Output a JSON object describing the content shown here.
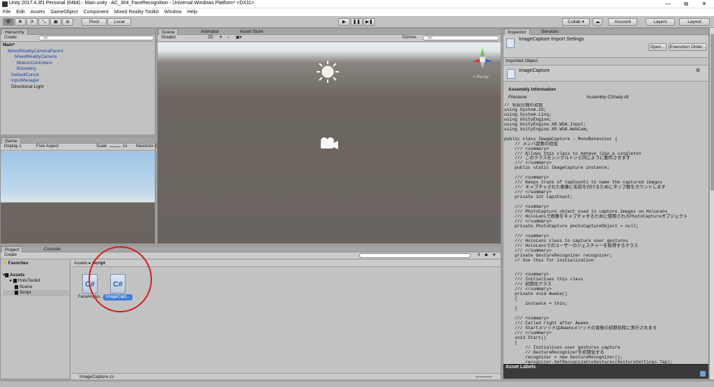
{
  "window": {
    "title": "Unity 2017.4.3f1 Personal (64bit) - Main.unity - AC_304_FaceRecognition - Universal Windows Platform* <DX11>",
    "minimize": "—",
    "maximize": "⧉",
    "close": "✕"
  },
  "menu": [
    "File",
    "Edit",
    "Assets",
    "GameObject",
    "Component",
    "Mixed Reality Toolkit",
    "Window",
    "Help"
  ],
  "toolbar": {
    "pivot": "Pivot",
    "local": "Local",
    "play": "▶",
    "pause": "❚❚",
    "step": "▶❚",
    "collab": "Collab ▾",
    "account": "Account",
    "layers": "Layers",
    "layout": "Layout"
  },
  "hierarchy": {
    "tab": "Hierarchy",
    "create": "Create",
    "search_placeholder": "All",
    "scene": "Main*",
    "items": [
      {
        "label": "MixedRealityCameraParent"
      },
      {
        "label": "MixedRealityCamera"
      },
      {
        "label": "MotionControllers"
      },
      {
        "label": "Boundary"
      },
      {
        "label": "DefaultCursor"
      },
      {
        "label": "InputManager"
      },
      {
        "label": "Directional Light"
      }
    ]
  },
  "game": {
    "tab": "Game",
    "display": "Display 1",
    "aspect": "Free Aspect",
    "scale_label": "Scale",
    "scale_value": "1x",
    "maximize": "Maximize O"
  },
  "scene": {
    "tabs": [
      "Scene",
      "Animator",
      "Asset Store"
    ],
    "shading": "Shaded",
    "mode2d": "2D",
    "gizmos": "Gizmos",
    "search_placeholder": "All",
    "persp": "< Persp"
  },
  "project": {
    "tabs": [
      "Project",
      "Console"
    ],
    "create": "Create",
    "favorites": "Favorites",
    "assets": "Assets",
    "tree": [
      {
        "label": "HoloToolkit"
      },
      {
        "label": "Scene"
      },
      {
        "label": "Script"
      }
    ],
    "breadcrumb_root": "Assets",
    "breadcrumb_sep": "▸",
    "breadcrumb_current": "Script",
    "files": [
      {
        "label": "FaceAnalys...",
        "icon": "C#"
      },
      {
        "label": "ImageCapt...",
        "icon": "C#"
      }
    ],
    "count": "4",
    "footer_file": "ImageCapture.cs"
  },
  "inspector": {
    "tabs": [
      "Inspector",
      "Services"
    ],
    "title": "ImageCapture Import Settings",
    "open_btn": "Open...",
    "exec_order_btn": "Execution Order...",
    "imported_object": "Imported Object",
    "object_name": "ImageCapture",
    "assembly_heading": "Assembly Information",
    "filename_label": "Filename",
    "filename_value": "Assembly-CSharp.dll",
    "asset_labels": "Asset Labels",
    "code": "// 名前空間の追加\nusing System.IO;\nusing System.Linq;\nusing UnityEngine;\nusing UnityEngine.XR.WSA.Input;\nusing UnityEngine.XR.WSA.WebCam;\n\npublic class ImageCapture : MonoBehaviour {\n    // メンバ変数の追加\n    /// <summary>\n    /// Allows this class to behave like a singleton\n    /// このクラスをシングルトンと同じように動作させます\n    /// </summary>\n    public static ImageCapture instance;\n\n    /// <summary>\n    /// Keeps track of tapCounts to name the captured images\n    /// キャプチャされた画像に名前を付けるためにタップ数をカウントします\n    /// </summary>\n    private int tapsCount;\n\n    /// <summary>\n    /// PhotoCapture object used to capture images on HoloLens\n    /// HoloLensで画像をキャプチャするために使用されるPhotoCaptureオブジェクト\n    /// </summary>\n    private PhotoCapture photoCaptureObject = null;\n\n    /// <summary>\n    /// HoloLens class to capture user gestures\n    /// HoloLensでのユーザーのジェスチャーを取得するクラス\n    /// </summary>\n    private GestureRecognizer recognizer;\n    // Use this for initialization\n\n\n    /// <summary>\n    /// Initialises this class\n    /// 初期化クラス\n    /// </summary>\n    private void Awake()\n    {\n        instance = this;\n    }\n\n    /// <summary>\n    /// Called right after Awake\n    /// StartメソッドはAwakeメソッドの直後の初期化時に実行されます\n    /// </summary>\n    void Start()\n    {\n        // Initialises user gestures capture\n        // GestureRecognizerを初期化する\n        recognizer = new GestureRecognizer();\n        recognizer.SetRecognizableGestures(GestureSettings.Tap);"
  },
  "colors": {
    "annotation_circle": "#d01f1f",
    "selection": "#3d7fd9",
    "tree_blue": "#1a3fa6"
  }
}
